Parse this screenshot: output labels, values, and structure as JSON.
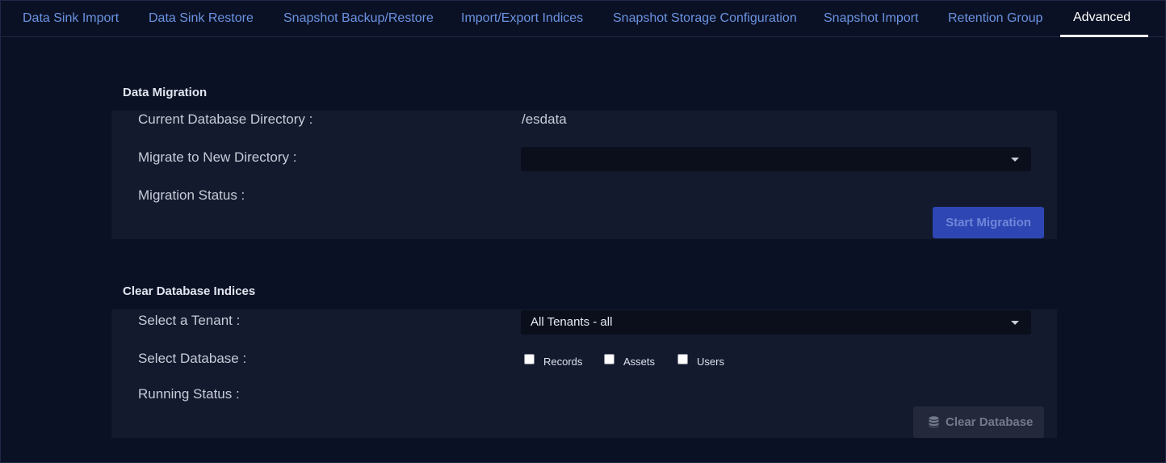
{
  "tabs": [
    {
      "label": "Data Sink Import"
    },
    {
      "label": "Data Sink Restore"
    },
    {
      "label": "Snapshot Backup/Restore"
    },
    {
      "label": "Import/Export Indices"
    },
    {
      "label": "Snapshot Storage Configuration"
    },
    {
      "label": "Snapshot Import"
    },
    {
      "label": "Retention Group"
    },
    {
      "label": "Advanced"
    }
  ],
  "active_tab": "Advanced",
  "data_migration": {
    "title": "Data Migration",
    "current_dir_label": "Current Database Directory :",
    "current_dir_value": "/esdata",
    "migrate_label": "Migrate to New Directory :",
    "migrate_value": "",
    "status_label": "Migration Status :",
    "start_button": "Start Migration"
  },
  "clear_indices": {
    "title": "Clear Database Indices",
    "tenant_label": "Select a Tenant :",
    "tenant_value": "All Tenants - all",
    "database_label": "Select Database :",
    "databases": [
      "Records",
      "Assets",
      "Users"
    ],
    "running_status_label": "Running Status :",
    "clear_button": "Clear Database",
    "clear_button_icon": "database-icon"
  },
  "colors": {
    "background": "#0b1124",
    "panel": "#131a2e",
    "tab_text": "#6a93e2",
    "primary_button": "#2e46b3",
    "disabled_button": "#23293a"
  }
}
